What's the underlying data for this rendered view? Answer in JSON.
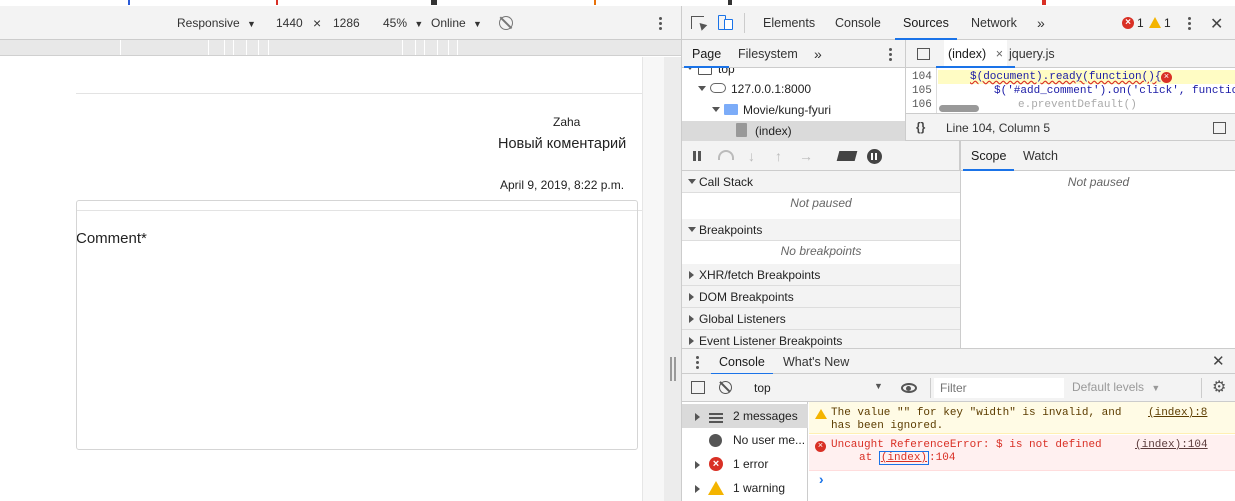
{
  "device_toolbar": {
    "responsive": "Responsive",
    "width": "1440",
    "times": "×",
    "height": "1286",
    "zoom": "45%",
    "network": "Online"
  },
  "page": {
    "author": "Zaha",
    "comment_text": "Новый коментарий",
    "date": "April 9, 2019, 8:22 p.m.",
    "comment_label": "Comment*"
  },
  "devtools": {
    "tabs": [
      "Elements",
      "Console",
      "Sources",
      "Network"
    ],
    "more": "»",
    "error_count": "1",
    "warning_count": "1",
    "navigator_tabs": [
      "Page",
      "Filesystem"
    ],
    "file_tree": {
      "top": "top",
      "host": "127.0.0.1:8000",
      "folder": "Movie/kung-fyuri",
      "file": "(index)"
    },
    "editor_tabs": [
      "(index)",
      "jquery.js"
    ],
    "editor_tab_close": "×",
    "code_lines": [
      {
        "num": "104",
        "code": "$(document).ready(function(){"
      },
      {
        "num": "105",
        "code": "$('#add_comment').on('click', functio"
      },
      {
        "num": "106",
        "code": "e.preventDefault()"
      }
    ],
    "cursor_position": "Line 104, Column 5",
    "format_icon": "{}",
    "call_stack": "Call Stack",
    "call_stack_status": "Not paused",
    "breakpoints": "Breakpoints",
    "breakpoints_status": "No breakpoints",
    "xhr_breakpoints": "XHR/fetch Breakpoints",
    "dom_breakpoints": "DOM Breakpoints",
    "global_listeners": "Global Listeners",
    "event_breakpoints": "Event Listener Breakpoints",
    "scope_tabs": [
      "Scope",
      "Watch"
    ],
    "scope_status": "Not paused",
    "drawer_tabs": [
      "Console",
      "What's New"
    ],
    "context": "top",
    "filter_placeholder": "Filter",
    "levels": "Default levels",
    "sidebar": [
      {
        "label": "2 messages",
        "icon": "list-icon"
      },
      {
        "label": "No user me...",
        "icon": "user-icon"
      },
      {
        "label": "1 error",
        "icon": "error-icon"
      },
      {
        "label": "1 warning",
        "icon": "warning-icon"
      }
    ],
    "messages": [
      {
        "type": "warning",
        "text1": "The value \"\" for key \"width\" is invalid, and",
        "text2": "has been ignored.",
        "source": "(index):8"
      },
      {
        "type": "error",
        "text1": "Uncaught ReferenceError: $ is not defined",
        "text2_prefix": "at ",
        "text2_link": "(index)",
        "text2_suffix": ":104",
        "source": "(index):104"
      }
    ],
    "prompt": "›"
  },
  "colors": {
    "accent": "#1a73e8",
    "error": "#d93025",
    "warning": "#f4b400",
    "error_bg": "#fff0f0",
    "warning_bg": "#fffbe5"
  }
}
